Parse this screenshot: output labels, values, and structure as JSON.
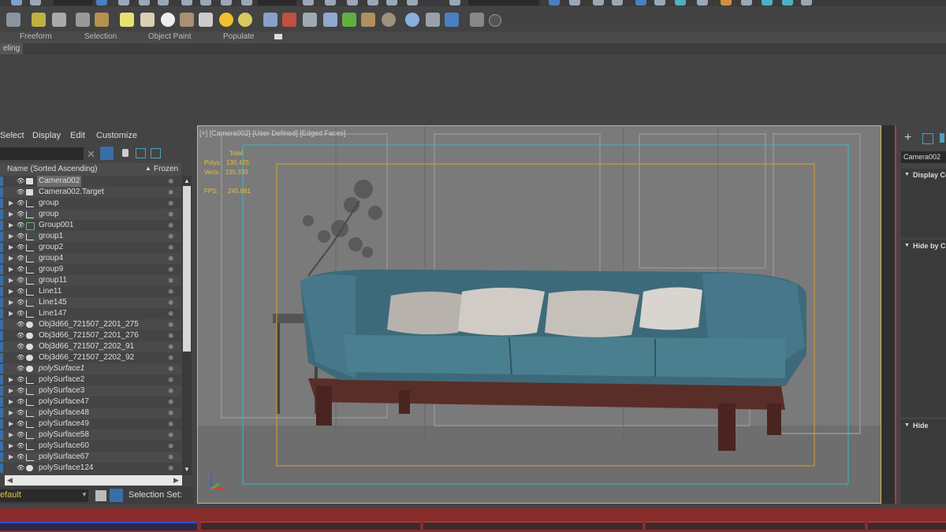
{
  "ribbon": {
    "tabs": [
      "Freeform",
      "Selection",
      "Object Paint",
      "Populate"
    ],
    "modeling_label": "eling"
  },
  "explorer": {
    "menu": [
      "Select",
      "Display",
      "Edit",
      "Customize"
    ],
    "column_name": "Name (Sorted Ascending)",
    "column_frozen": "Frozen",
    "rows": [
      {
        "name": "Camera002",
        "type": "camera",
        "selected": true,
        "italic": false
      },
      {
        "name": "Camera002.Target",
        "type": "camera",
        "selected": false,
        "italic": false
      },
      {
        "name": "group",
        "type": "shape",
        "selected": false,
        "italic": false
      },
      {
        "name": "group",
        "type": "shape",
        "selected": false,
        "italic": false
      },
      {
        "name": "Group001",
        "type": "group",
        "selected": false,
        "italic": false
      },
      {
        "name": "group1",
        "type": "shape",
        "selected": false,
        "italic": false
      },
      {
        "name": "group2",
        "type": "shape",
        "selected": false,
        "italic": false
      },
      {
        "name": "group4",
        "type": "shape",
        "selected": false,
        "italic": false
      },
      {
        "name": "group9",
        "type": "shape",
        "selected": false,
        "italic": false
      },
      {
        "name": "group11",
        "type": "shape",
        "selected": false,
        "italic": false
      },
      {
        "name": "Line11",
        "type": "shape",
        "selected": false,
        "italic": false
      },
      {
        "name": "Line145",
        "type": "shape",
        "selected": false,
        "italic": false
      },
      {
        "name": "Line147",
        "type": "shape",
        "selected": false,
        "italic": false
      },
      {
        "name": "Obj3d66_721507_2201_275",
        "type": "geo",
        "selected": false,
        "italic": false
      },
      {
        "name": "Obj3d66_721507_2201_276",
        "type": "geo",
        "selected": false,
        "italic": false
      },
      {
        "name": "Obj3d66_721507_2202_91",
        "type": "geo",
        "selected": false,
        "italic": false
      },
      {
        "name": "Obj3d66_721507_2202_92",
        "type": "geo",
        "selected": false,
        "italic": false
      },
      {
        "name": "polySurface1",
        "type": "geo",
        "selected": false,
        "italic": true
      },
      {
        "name": "polySurface2",
        "type": "shape",
        "selected": false,
        "italic": false
      },
      {
        "name": "polySurface3",
        "type": "shape",
        "selected": false,
        "italic": false
      },
      {
        "name": "polySurface47",
        "type": "shape",
        "selected": false,
        "italic": false
      },
      {
        "name": "polySurface48",
        "type": "shape",
        "selected": false,
        "italic": false
      },
      {
        "name": "polySurface49",
        "type": "shape",
        "selected": false,
        "italic": false
      },
      {
        "name": "polySurface58",
        "type": "shape",
        "selected": false,
        "italic": false
      },
      {
        "name": "polySurface60",
        "type": "shape",
        "selected": false,
        "italic": false
      },
      {
        "name": "polySurface67",
        "type": "shape",
        "selected": false,
        "italic": false
      },
      {
        "name": "polySurface124",
        "type": "geo",
        "selected": false,
        "italic": false
      }
    ],
    "layer_value": "efault",
    "selection_set_label": "Selection Set:"
  },
  "viewport": {
    "label": "[+] [Camera002] [User Defined] [Edged Faces]",
    "stats_total": "Total",
    "stats_polys_label": "Polys:",
    "stats_polys": "130,425",
    "stats_verts_label": "Verts:",
    "stats_verts": "135,330",
    "stats_fps_label": "FPS:",
    "stats_fps": "245.881"
  },
  "cmdpanel": {
    "name_field": "Camera002",
    "rollouts": [
      "Display Co",
      "Hide by C",
      "Hide"
    ]
  }
}
